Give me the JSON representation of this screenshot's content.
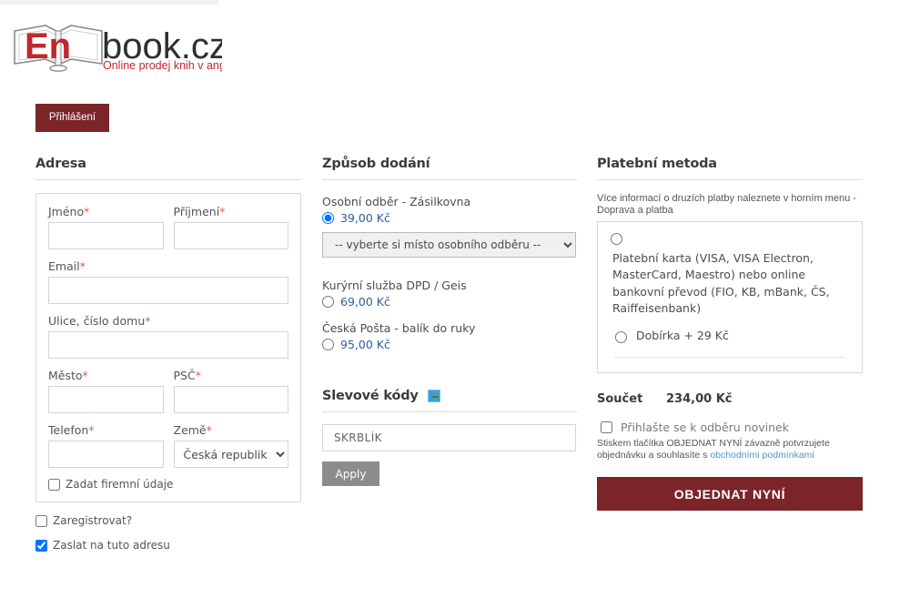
{
  "brand": {
    "logo_main": "book.cz",
    "logo_mark": "En",
    "tagline": "Online prodej knih v angličtině",
    "accent_red": "#c0272d",
    "dark_red": "#7b2529"
  },
  "header": {
    "login_label": "Přihlášení"
  },
  "address": {
    "title": "Adresa",
    "fields": {
      "first_name": {
        "label": "Jméno",
        "required": "*",
        "value": "",
        "placeholder": ""
      },
      "last_name": {
        "label": "Příjmení",
        "required": "*",
        "value": "",
        "placeholder": ""
      },
      "email": {
        "label": "Email",
        "required": "*",
        "value": "",
        "placeholder": ""
      },
      "street": {
        "label": "Ulice, číslo domu",
        "required": "*",
        "value": "",
        "placeholder": ""
      },
      "city": {
        "label": "Město",
        "required": "*",
        "value": "",
        "placeholder": ""
      },
      "zip": {
        "label": "PSČ",
        "required": "*",
        "value": "",
        "placeholder": ""
      },
      "phone": {
        "label": "Telefon",
        "required": "*",
        "value": "",
        "placeholder": ""
      },
      "country": {
        "label": "Země",
        "required": "*",
        "selected": "Česká republika",
        "options": [
          "Česká republika"
        ]
      }
    },
    "company_checkbox": {
      "label": "Zadat firemní údaje",
      "checked": false
    },
    "register_checkbox": {
      "label": "Zaregistrovat?",
      "checked": false
    },
    "same_address_checkbox": {
      "label": "Zaslat na tuto adresu",
      "checked": true
    }
  },
  "delivery": {
    "title": "Způsob dodání",
    "options": [
      {
        "name": "Osobní odběr - Zásilkovna",
        "price": "39,00 Kč",
        "selected": true
      },
      {
        "name": "Kurýrní služba DPD / Geis",
        "price": "69,00 Kč",
        "selected": false
      },
      {
        "name": "Česká Pošta - balík do ruky",
        "price": "95,00 Kč",
        "selected": false
      }
    ],
    "pickup_select": {
      "selected": "-- vyberte si místo osobního odběru --",
      "options": [
        "-- vyberte si místo osobního odběru --"
      ]
    }
  },
  "coupon": {
    "title": "Slevové kódy",
    "toggle_icon": "minus-toggle-icon",
    "input_value": "SKRBLÍK",
    "placeholder": "",
    "apply_label": "Apply"
  },
  "payment": {
    "title": "Platební metoda",
    "note": "Více informací o druzích platby naleznete v horním menu - Doprava a platba",
    "options": [
      {
        "label": "Platební karta (VISA, VISA Electron, MasterCard, Maestro) nebo online bankovní převod (FIO, KB, mBank, ČS, Raiffeisenbank)",
        "selected": false
      },
      {
        "label": "Dobírka + 29 Kč",
        "selected": false
      }
    ]
  },
  "summary": {
    "total_label": "Součet",
    "total_value": "234,00 Kč",
    "newsletter_label": "Přihlašte se k odběru novinek",
    "newsletter_checked": false,
    "terms_prefix": "Stiskem tlačítka OBJEDNAT NYNÍ závazně potvrzujete objednávku a souhlasíte s ",
    "terms_link": "obchodními podmínkami",
    "order_button": "OBJEDNAT NYNÍ"
  }
}
